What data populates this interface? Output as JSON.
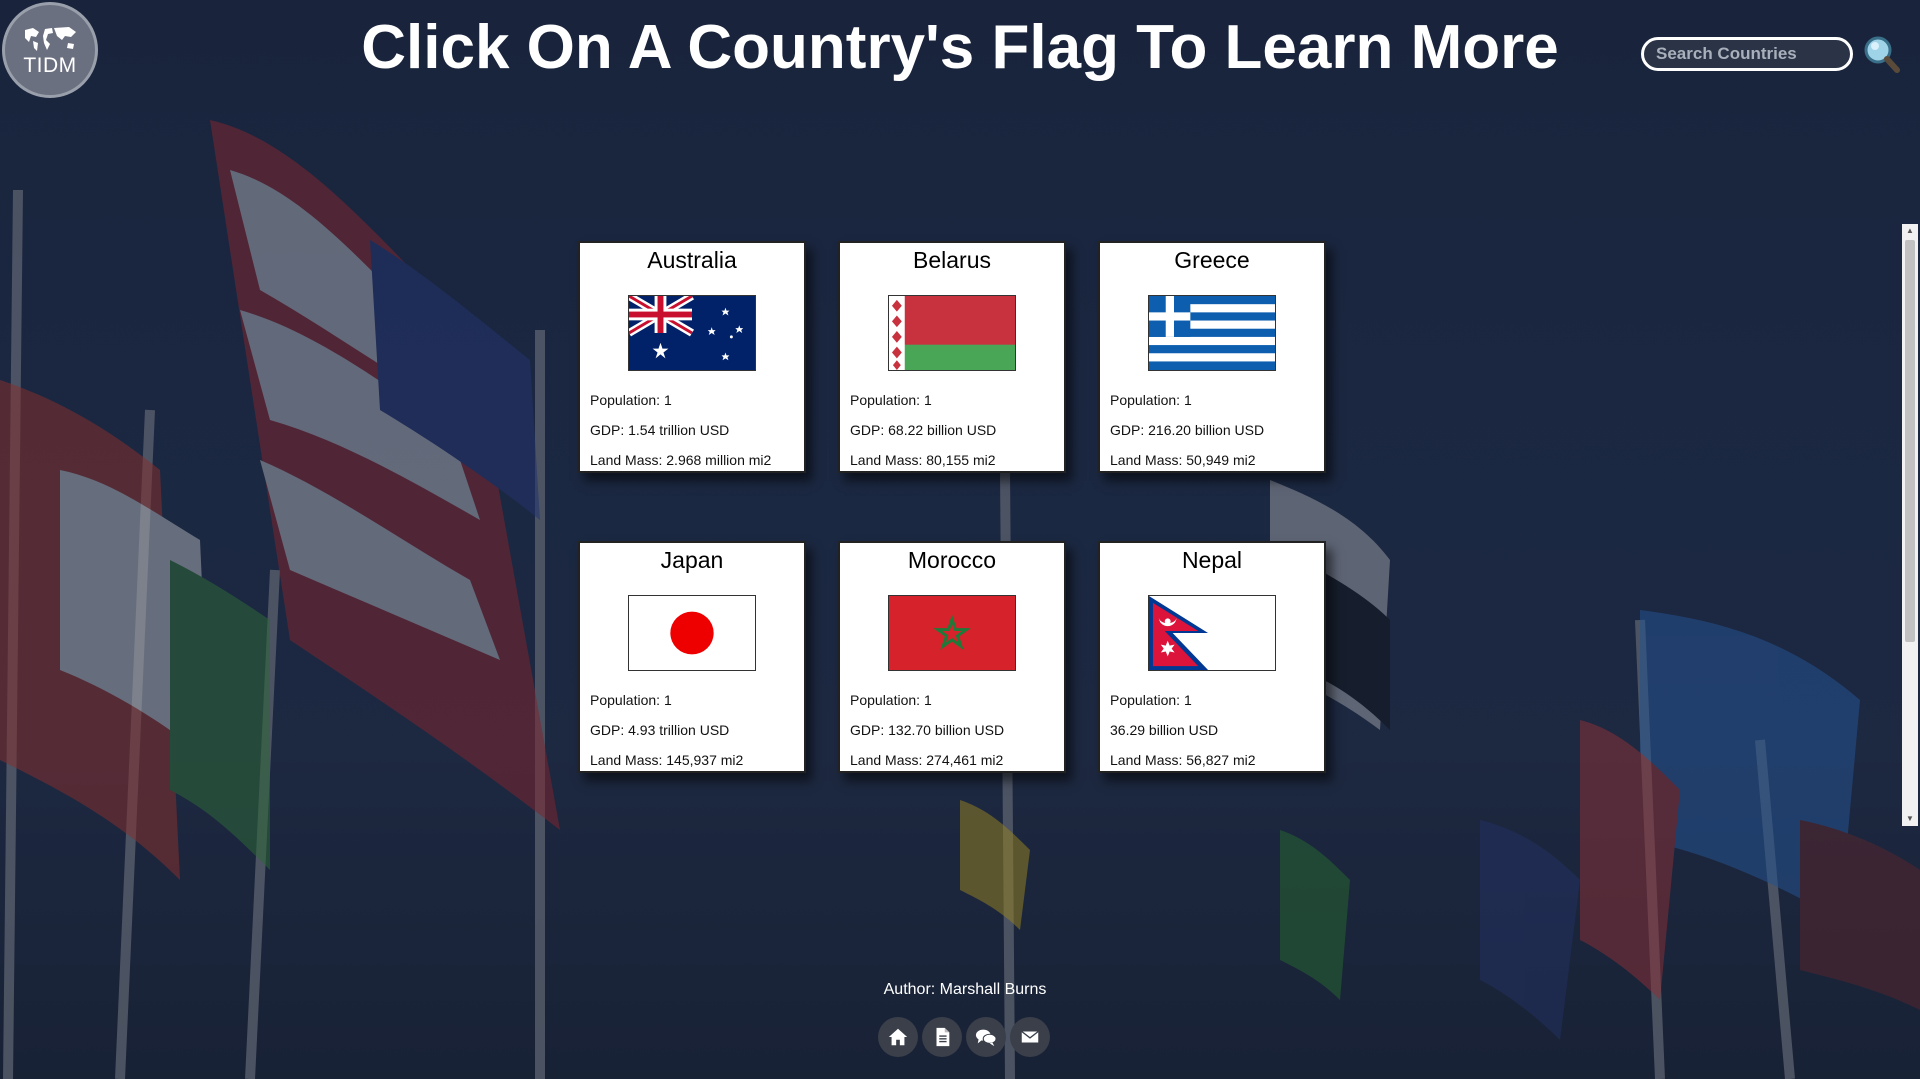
{
  "header": {
    "logo_text": "TIDM",
    "title": "Click On A Country's Flag To Learn More",
    "search_placeholder": "Search Countries"
  },
  "countries": [
    {
      "name": "Australia",
      "flag": "australia-flag",
      "population": "Population: 1",
      "gdp": "GDP: 1.54 trillion USD",
      "land_mass": "Land Mass: 2.968 million mi2"
    },
    {
      "name": "Belarus",
      "flag": "belarus-flag",
      "population": "Population: 1",
      "gdp": "GDP: 68.22 billion USD",
      "land_mass": "Land Mass: 80,155 mi2"
    },
    {
      "name": "Greece",
      "flag": "greece-flag",
      "population": "Population: 1",
      "gdp": "GDP: 216.20 billion USD",
      "land_mass": "Land Mass: 50,949 mi2"
    },
    {
      "name": "Japan",
      "flag": "japan-flag",
      "population": "Population: 1",
      "gdp": "GDP: 4.93 trillion USD",
      "land_mass": "Land Mass: 145,937 mi2"
    },
    {
      "name": "Morocco",
      "flag": "morocco-flag",
      "population": "Population: 1",
      "gdp": "GDP: 132.70 billion USD",
      "land_mass": "Land Mass: 274,461 mi2"
    },
    {
      "name": "Nepal",
      "flag": "nepal-flag",
      "population": "Population: 1",
      "gdp": "36.29 billion USD",
      "land_mass": "Land Mass: 56,827 mi2"
    }
  ],
  "footer": {
    "author": "Author: Marshall Burns",
    "icons": [
      "home-icon",
      "document-icon",
      "chat-icon",
      "mail-icon"
    ]
  },
  "colors": {
    "background": "#1f2d4a",
    "card": "#ffffff",
    "title": "#ffffff"
  }
}
